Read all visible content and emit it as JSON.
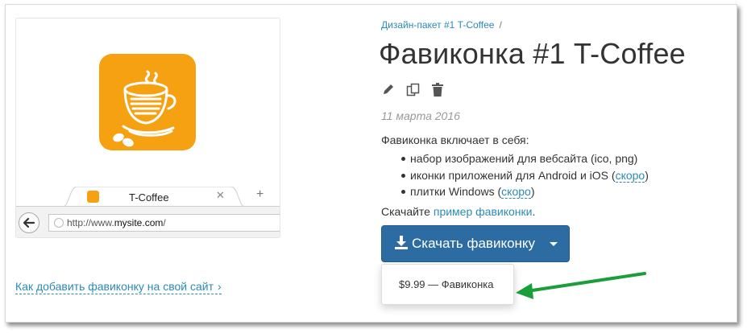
{
  "preview": {
    "tab_title": "T-Coffee",
    "tab_close": "✕",
    "new_tab": "+",
    "url_prefix": "http://www.",
    "url_domain": "mysite.com",
    "url_suffix": "/"
  },
  "howto": {
    "label": "Как добавить фавиконку на свой сайт",
    "chevron": "›"
  },
  "breadcrumb": {
    "item": "Дизайн-пакет #1 T-Coffee",
    "separator": "/"
  },
  "title": "Фавиконка #1 T-Coffee",
  "actions": {
    "edit": "edit-icon",
    "copy": "copy-icon",
    "delete": "trash-icon"
  },
  "date": "11 марта 2016",
  "intro": "Фавиконка включает в себя:",
  "features": [
    {
      "text": "набор изображений для вебсайта (ico, png)",
      "link": ""
    },
    {
      "text": "иконки приложений для Android и iOS (",
      "link": "скоро",
      "after": ")"
    },
    {
      "text": "плитки Windows (",
      "link": "скоро",
      "after": ")"
    }
  ],
  "example": {
    "prefix": "Скачайте ",
    "link": "пример фавиконки",
    "suffix": "."
  },
  "download": {
    "label": "Скачать фавиконку"
  },
  "dropdown": {
    "item": "$9.99 — Фавиконка"
  },
  "colors": {
    "accent": "#2a8bb5",
    "button": "#2d6ca2",
    "favicon": "#f5a111",
    "annotation_arrow": "#1a9e3a"
  }
}
